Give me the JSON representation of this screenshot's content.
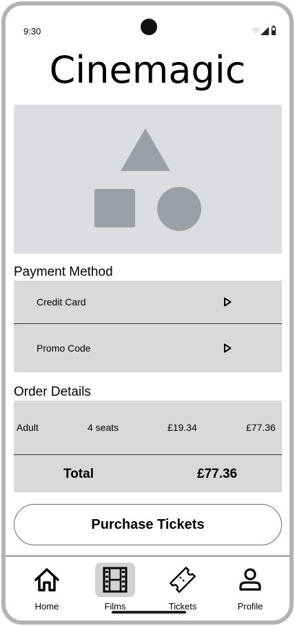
{
  "status_bar": {
    "time": "9:30"
  },
  "app": {
    "title": "Cinemagic"
  },
  "payment": {
    "section_title": "Payment Method",
    "options": [
      {
        "label": "Credit Card",
        "icon": "play-arrow-icon"
      },
      {
        "label": "Promo Code",
        "icon": "play-arrow-icon"
      }
    ]
  },
  "order": {
    "section_title": "Order Details",
    "line": {
      "type": "Adult",
      "seats": "4 seats",
      "unit_price": "£19.34",
      "line_total": "£77.36"
    },
    "total_label": "Total",
    "total_value": "£77.36"
  },
  "actions": {
    "purchase_label": "Purchase Tickets"
  },
  "nav": {
    "items": [
      {
        "label": "Home",
        "icon": "home-icon",
        "active": false
      },
      {
        "label": "Films",
        "icon": "film-icon",
        "active": true
      },
      {
        "label": "Tickets",
        "icon": "ticket-icon",
        "active": false
      },
      {
        "label": "Profile",
        "icon": "profile-icon",
        "active": false
      }
    ]
  },
  "colors": {
    "placeholder_bg": "#dcdde0",
    "placeholder_shape": "#9aa0a6",
    "row_bg": "#d9d9d9",
    "active_nav_bg": "#d2d2d2",
    "frame": "#b3b3b3"
  }
}
